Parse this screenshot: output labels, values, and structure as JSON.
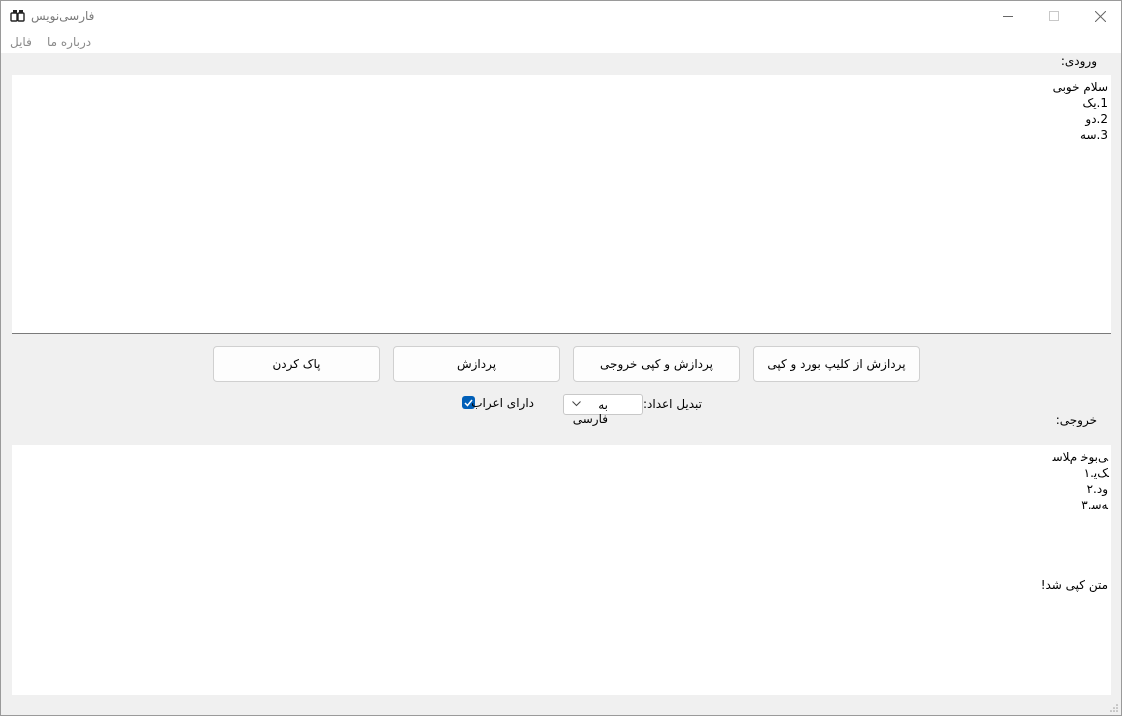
{
  "window": {
    "title": "فارسی‌نویس",
    "icon": "keyboard-app-icon"
  },
  "menu": {
    "file_label": "فایل",
    "about_label": "درباره ما"
  },
  "input_section": {
    "label": "ورودی:",
    "lines": [
      "سلام خوبی",
      "1.یک",
      "2.دو",
      "3.سه"
    ]
  },
  "buttons": {
    "process_clipboard_copy": "پردازش از کلیپ بورد و کپی",
    "process_copy_output": "پردازش و کپی خروجی",
    "process": "پردازش",
    "clear": "پاک کردن"
  },
  "options": {
    "number_conversion_label": "تبدیل اعداد:",
    "number_conversion_value": "به فارسی",
    "diacritics_label": "دارای اعراب",
    "diacritics_checked": true
  },
  "output_section": {
    "label": "خروجی:",
    "lines": [
      "ﯽﺑﻮﺧ ﻡﻼﺳ",
      "ﮏﯾ.١",
      "ﻭﺩ.٢",
      "ﻪﺳ.٣"
    ],
    "status": "متن کپی شد!"
  },
  "colors": {
    "accent": "#005fb8",
    "background": "#f0f0f0"
  }
}
